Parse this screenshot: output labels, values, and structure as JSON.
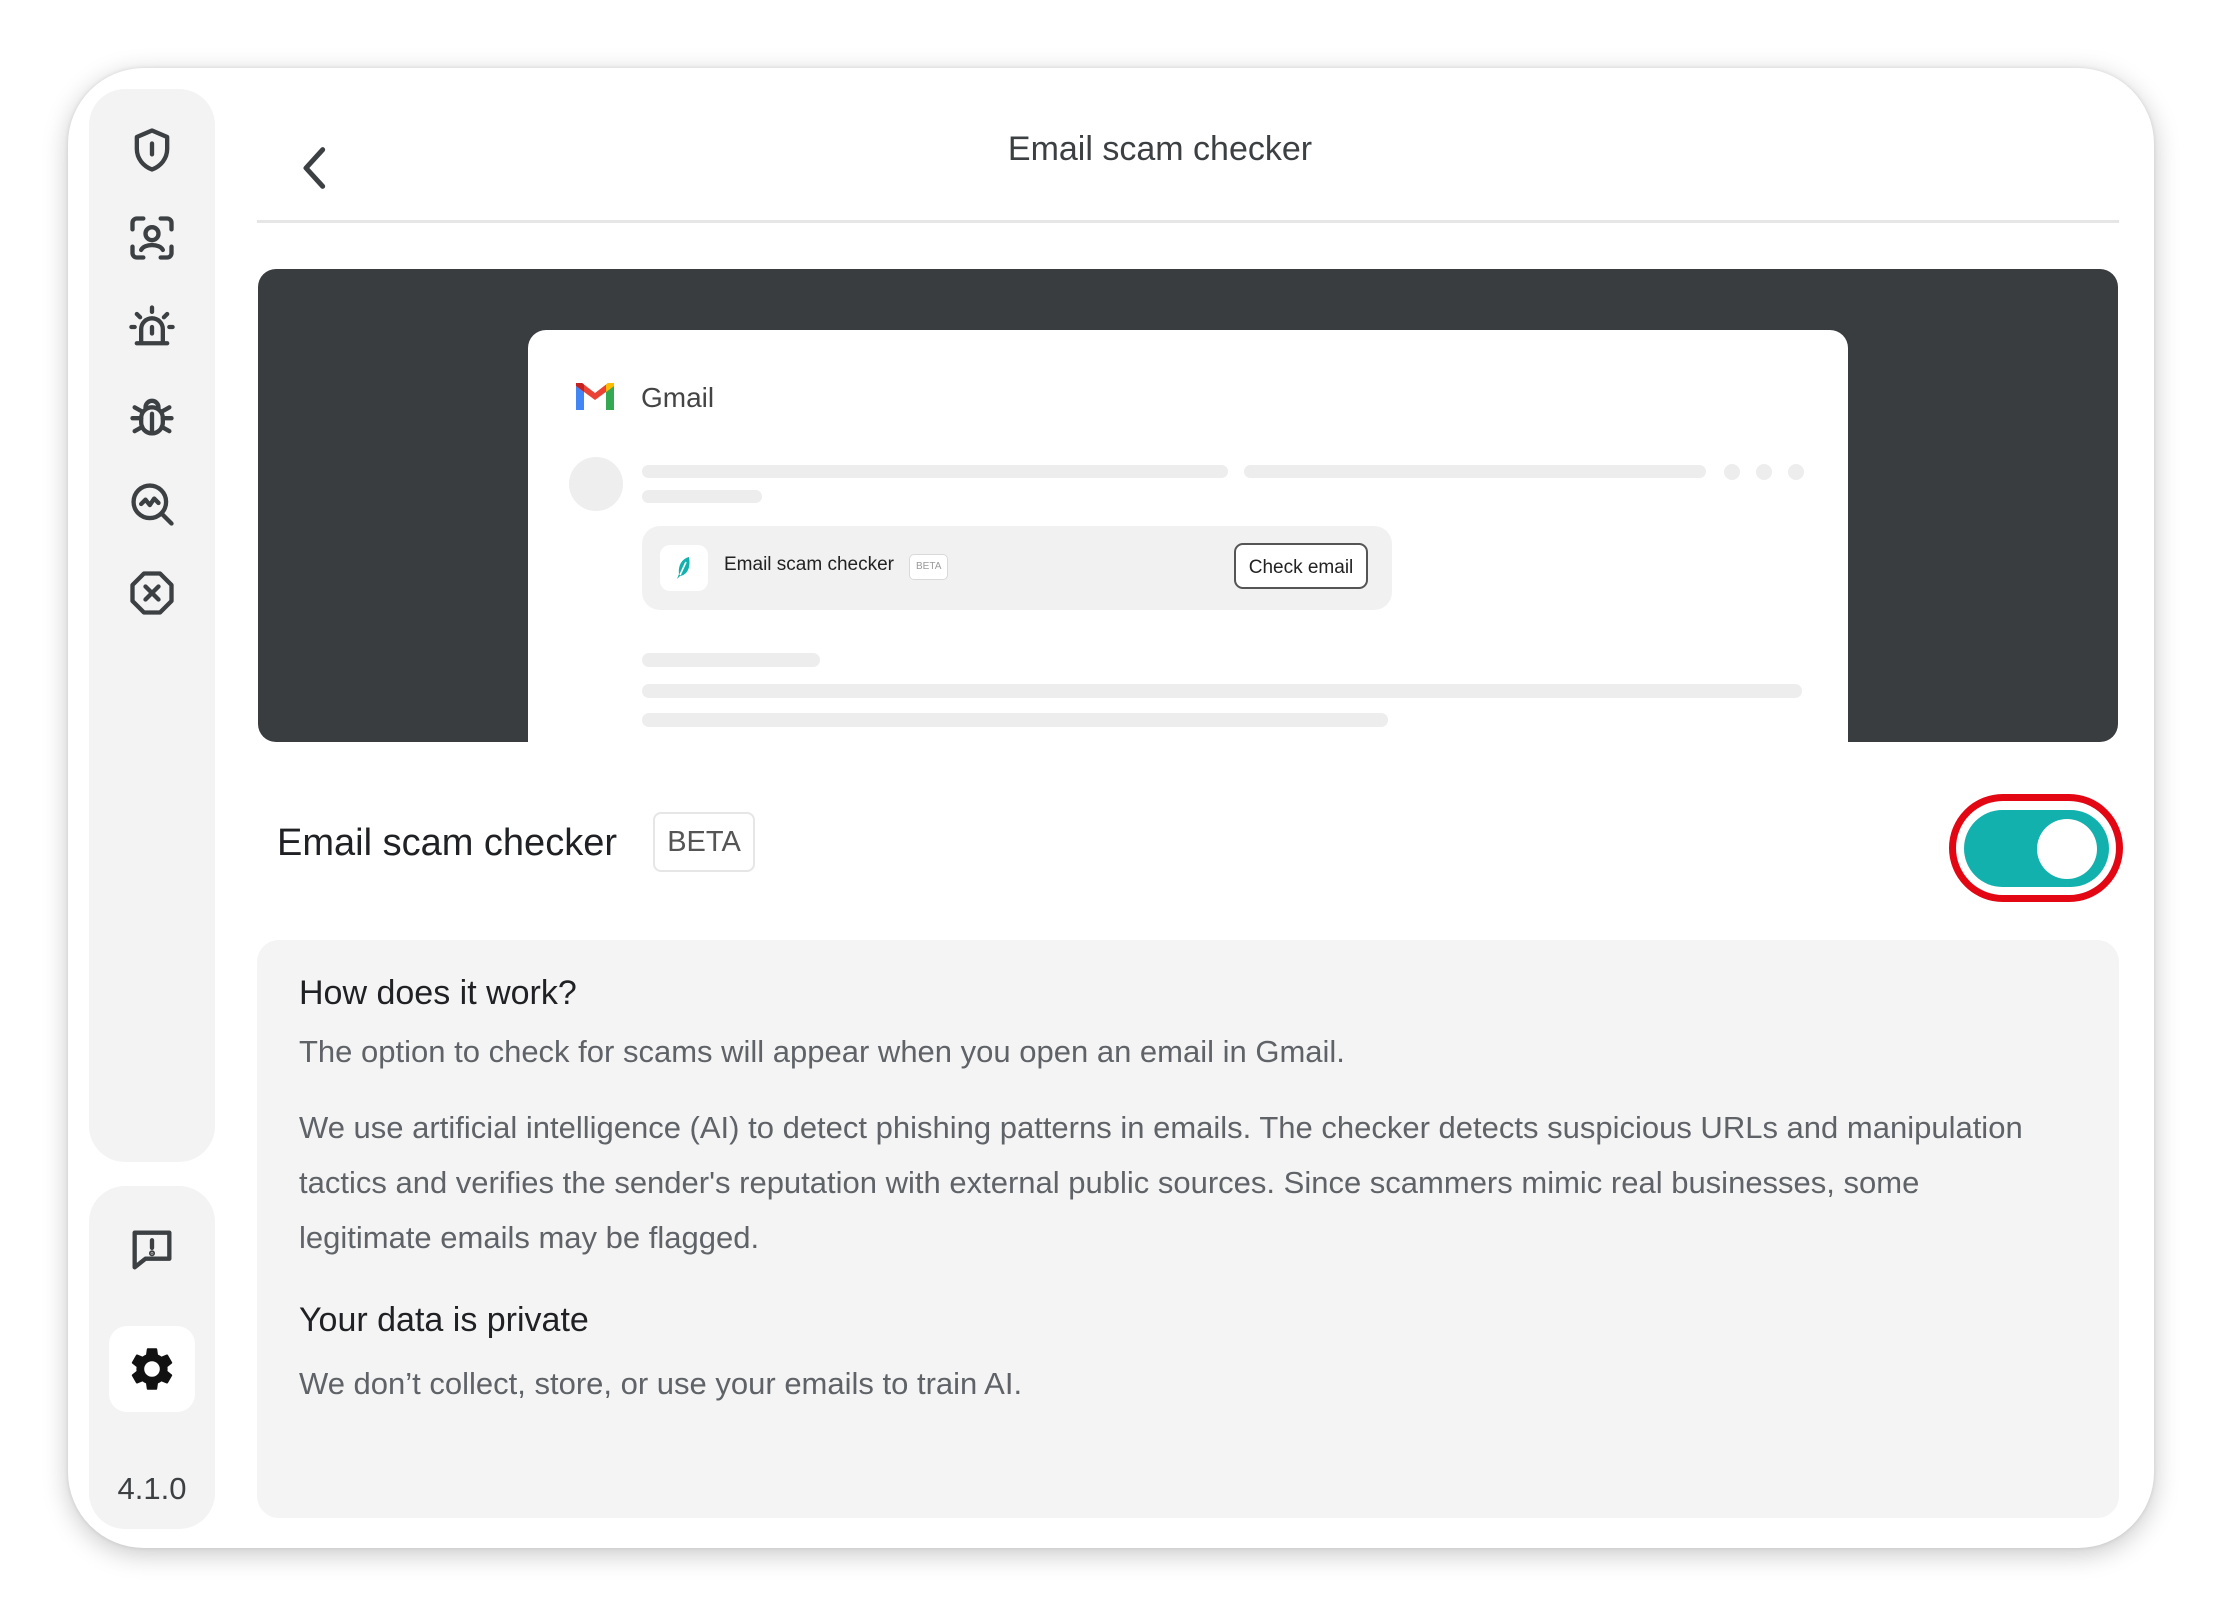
{
  "app": {
    "version": "4.1.0"
  },
  "sidebar": {
    "items": [
      {
        "icon": "shield-icon"
      },
      {
        "icon": "identity-scan-icon"
      },
      {
        "icon": "alarm-icon"
      },
      {
        "icon": "bug-icon"
      },
      {
        "icon": "search-scan-icon"
      },
      {
        "icon": "blocked-icon"
      }
    ],
    "bottom": [
      {
        "icon": "feedback-icon"
      },
      {
        "icon": "gear-icon",
        "active": true
      }
    ]
  },
  "header": {
    "title": "Email scam checker",
    "back_icon": "chevron-left-icon"
  },
  "preview": {
    "app_name": "Gmail",
    "extension_label": "Email scam checker",
    "extension_badge": "BETA",
    "check_button": "Check email"
  },
  "feature": {
    "title": "Email scam checker",
    "badge": "BETA",
    "enabled": true
  },
  "info": {
    "how_title": "How does it work?",
    "how_p1": "The option to check for scams will appear when you open an email in Gmail.",
    "how_p2": "We use artificial intelligence (AI) to detect phishing patterns in emails. The checker detects suspicious URLs and manipulation tactics and verifies the sender's reputation with external public sources. Since scammers mimic real businesses, some legitimate emails may be flagged.",
    "privacy_title": "Your data is private",
    "privacy_p": "We don’t collect, store, or use your emails to train AI."
  },
  "colors": {
    "toggle_on": "#13b1ad",
    "highlight": "#e30613",
    "banner_bg": "#3a3d40",
    "panel_bg": "#f4f4f4"
  }
}
